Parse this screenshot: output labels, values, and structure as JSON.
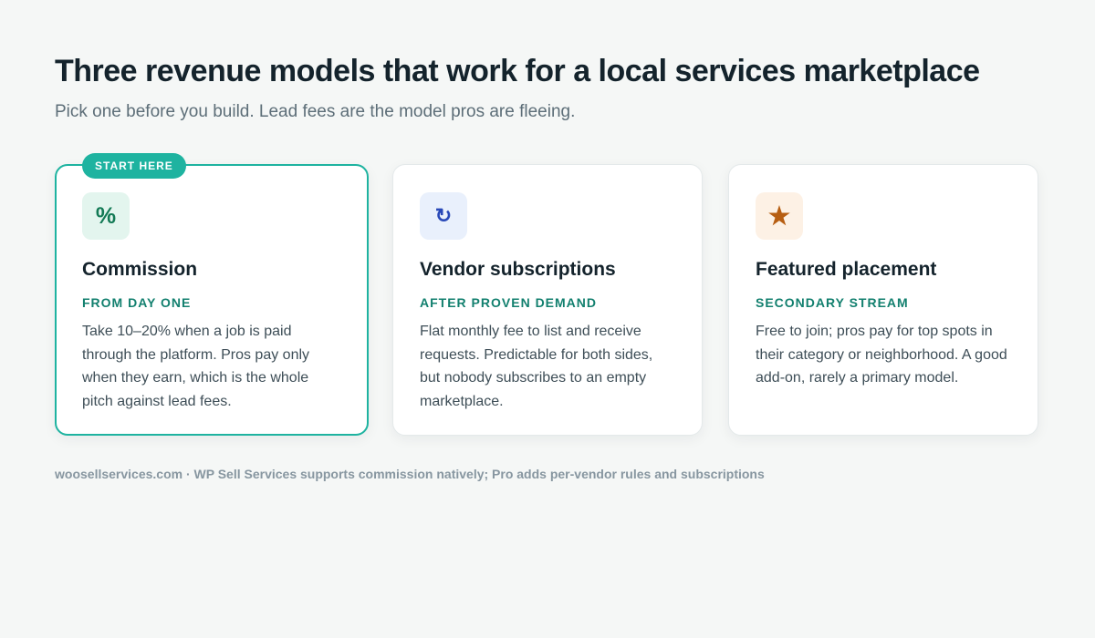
{
  "header": {
    "title": "Three revenue models that work for a local services marketplace",
    "subtitle": "Pick one before you build. Lead fees are the model pros are fleeing."
  },
  "cards": [
    {
      "badge": "START HERE",
      "icon": "%",
      "icon_name": "percent-icon",
      "title": "Commission",
      "tag": "FROM DAY ONE",
      "body": "Take 10–20% when a job is paid through the platform. Pros pay only when they earn, which is the whole pitch against lead fees.",
      "highlighted": true,
      "accent_color": "#1eb3a0"
    },
    {
      "icon": "↻",
      "icon_name": "refresh-icon",
      "title": "Vendor subscriptions",
      "tag": "AFTER PROVEN DEMAND",
      "body": "Flat monthly fee to list and receive requests. Predictable for both sides, but nobody subscribes to an empty marketplace.",
      "highlighted": false
    },
    {
      "icon": "★",
      "icon_name": "star-icon",
      "title": "Featured placement",
      "tag": "SECONDARY STREAM",
      "body": "Free to join; pros pay for top spots in their category or neighborhood. A good add-on, rarely a primary model.",
      "highlighted": false
    }
  ],
  "footer": {
    "text": "woosellservices.com · WP Sell Services supports commission natively; Pro adds per-vendor rules and subscriptions"
  },
  "colors": {
    "background": "#f5f7f6",
    "accent": "#1eb3a0",
    "tag": "#13806f",
    "title": "#14232c"
  }
}
